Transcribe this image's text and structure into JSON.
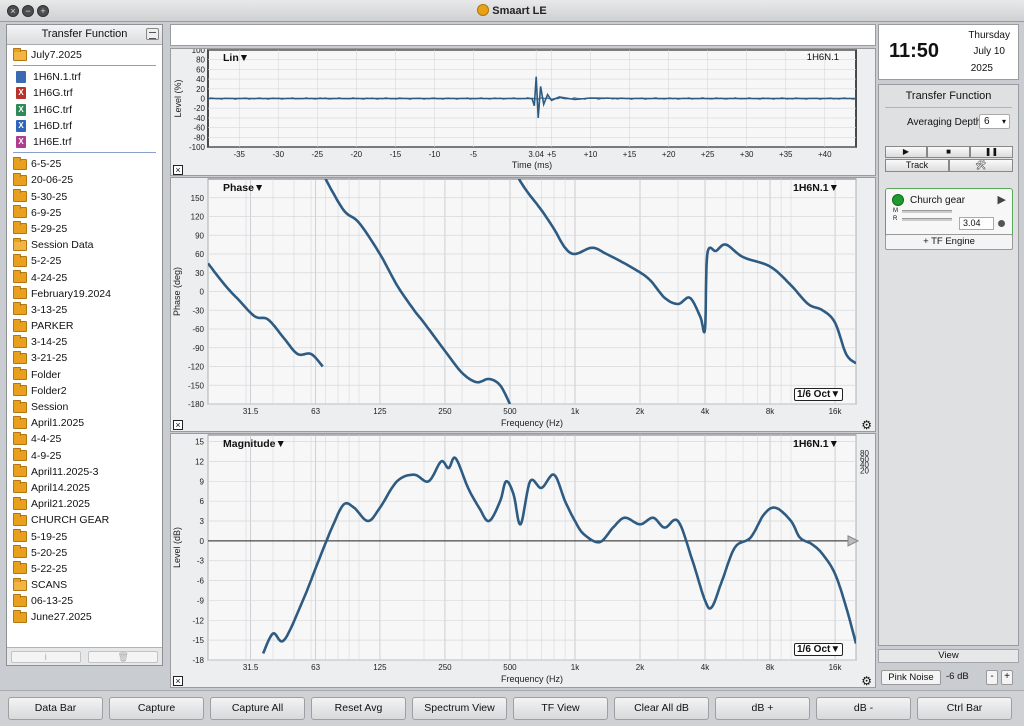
{
  "app": {
    "title": "Smaart LE",
    "traffic": [
      "×",
      "−",
      "+"
    ]
  },
  "sidebar": {
    "title": "Transfer Function",
    "root_folder": "July7.2025",
    "files": [
      {
        "label": "1H6N.1.trf",
        "color": "#3a6ab2",
        "glyph": ""
      },
      {
        "label": "1H6G.trf",
        "color": "#b8322c",
        "glyph": "X"
      },
      {
        "label": "1H6C.trf",
        "color": "#2f8a55",
        "glyph": "X"
      },
      {
        "label": "1H6D.trf",
        "color": "#2f64b8",
        "glyph": "X"
      },
      {
        "label": "1H6E.trf",
        "color": "#b03c8e",
        "glyph": "X"
      }
    ],
    "folders": [
      {
        "label": "6-5-25",
        "open": false
      },
      {
        "label": "20-06-25",
        "open": false
      },
      {
        "label": "5-30-25",
        "open": false
      },
      {
        "label": "6-9-25",
        "open": false
      },
      {
        "label": "5-29-25",
        "open": false
      },
      {
        "label": "Session Data",
        "open": true
      },
      {
        "label": "5-2-25",
        "open": false
      },
      {
        "label": "4-24-25",
        "open": false
      },
      {
        "label": "February19.2024",
        "open": false
      },
      {
        "label": "3-13-25",
        "open": false
      },
      {
        "label": "PARKER",
        "open": false
      },
      {
        "label": "3-14-25",
        "open": false
      },
      {
        "label": "3-21-25",
        "open": false
      },
      {
        "label": "Folder",
        "open": false
      },
      {
        "label": "Folder2",
        "open": false
      },
      {
        "label": "Session",
        "open": false
      },
      {
        "label": "April1.2025",
        "open": false
      },
      {
        "label": "4-4-25",
        "open": false
      },
      {
        "label": "4-9-25",
        "open": false
      },
      {
        "label": "April11.2025-3",
        "open": false
      },
      {
        "label": "April14.2025",
        "open": false
      },
      {
        "label": "April21.2025",
        "open": false
      },
      {
        "label": "CHURCH GEAR",
        "open": false
      },
      {
        "label": "5-19-25",
        "open": false
      },
      {
        "label": "5-20-25",
        "open": false
      },
      {
        "label": "5-22-25",
        "open": false
      },
      {
        "label": "SCANS",
        "open": true
      },
      {
        "label": "06-13-25",
        "open": false
      },
      {
        "label": "June27.2025",
        "open": false
      }
    ],
    "footer": {
      "info": "i",
      "trash": "🗑"
    }
  },
  "plots": {
    "impulse": {
      "mode": "Lin▼",
      "trace": "1H6N.1"
    },
    "phase": {
      "mode": "Phase▼",
      "trace": "1H6N.1▼",
      "smoothing": "1/6 Oct▼"
    },
    "magnitude": {
      "mode": "Magnitude▼",
      "trace": "1H6N.1▼",
      "smoothing": "1/6 Oct▼"
    }
  },
  "chart_data": [
    {
      "type": "line",
      "title": "Lin",
      "xlabel": "Time (ms)",
      "ylabel": "Level (%)",
      "xticks": [
        "-35",
        "-30",
        "-25",
        "-20",
        "-15",
        "-10",
        "-5",
        "3.04",
        "+5",
        "+10",
        "+15",
        "+20",
        "+25",
        "+30",
        "+35",
        "+40"
      ],
      "yticks": [
        "100",
        "80",
        "60",
        "40",
        "20",
        "0",
        "-20",
        "-40",
        "-60",
        "-80",
        "-100"
      ],
      "xlim": [
        -39,
        44
      ],
      "ylim": [
        -100,
        100
      ],
      "series": [
        {
          "name": "1H6N.1",
          "x": [
            -39,
            -20,
            -5,
            2.5,
            2.8,
            3.04,
            3.3,
            3.6,
            4,
            4.5,
            5,
            6,
            8,
            10,
            15,
            20,
            30,
            44
          ],
          "y": [
            0,
            0,
            0,
            0,
            -15,
            45,
            -40,
            25,
            -12,
            8,
            -4,
            3,
            -2,
            1,
            0,
            0,
            0,
            0
          ]
        }
      ]
    },
    {
      "type": "line",
      "title": "Phase",
      "xlabel": "Frequency (Hz)",
      "ylabel": "Phase (deg)",
      "xscale": "log",
      "xticks": [
        "31.5",
        "63",
        "125",
        "250",
        "500",
        "1k",
        "2k",
        "4k",
        "8k",
        "16k"
      ],
      "yticks": [
        "150",
        "120",
        "90",
        "60",
        "30",
        "0",
        "-30",
        "-60",
        "-90",
        "-120",
        "-150",
        "-180"
      ],
      "xlim": [
        20,
        20000
      ],
      "ylim": [
        -180,
        180
      ],
      "series": [
        {
          "name": "1H6N.1",
          "x": [
            20,
            24,
            28,
            33,
            38,
            45,
            52,
            60,
            68,
            70,
            85,
            100,
            125,
            150,
            180,
            200,
            250,
            300,
            350,
            400,
            450,
            500,
            550,
            600,
            700,
            800,
            900,
            1000,
            1200,
            1400,
            1800,
            2200,
            2600,
            3000,
            3400,
            3800,
            4000,
            4100,
            4500,
            5000,
            6000,
            8000,
            10000,
            12000,
            14000,
            16000,
            18000,
            20000
          ],
          "y": [
            45,
            10,
            -15,
            -40,
            -45,
            -75,
            -100,
            -100,
            -120,
            180,
            130,
            110,
            60,
            10,
            -30,
            -50,
            -95,
            -130,
            -145,
            -140,
            -150,
            -180,
            180,
            160,
            130,
            100,
            70,
            60,
            70,
            60,
            40,
            20,
            -10,
            -20,
            -10,
            -40,
            -60,
            60,
            65,
            75,
            55,
            40,
            10,
            -20,
            -30,
            -50,
            -100,
            -115
          ]
        }
      ]
    },
    {
      "type": "line",
      "title": "Magnitude",
      "xlabel": "Frequency (Hz)",
      "ylabel": "Level (dB)",
      "xscale": "log",
      "xticks": [
        "31.5",
        "63",
        "125",
        "250",
        "500",
        "1k",
        "2k",
        "4k",
        "8k",
        "16k"
      ],
      "yticks": [
        "15",
        "12",
        "9",
        "6",
        "3",
        "0",
        "-3",
        "-6",
        "-9",
        "-12",
        "-15",
        "-18"
      ],
      "y2ticks": [
        "80",
        "60",
        "40",
        "20"
      ],
      "xlim": [
        20,
        20000
      ],
      "ylim": [
        -18,
        16
      ],
      "series": [
        {
          "name": "1H6N.1",
          "x": [
            36,
            40,
            45,
            55,
            65,
            75,
            85,
            95,
            110,
            125,
            150,
            180,
            210,
            240,
            260,
            280,
            320,
            360,
            400,
            450,
            480,
            520,
            560,
            620,
            700,
            800,
            900,
            1000,
            1100,
            1300,
            1500,
            1700,
            2000,
            2300,
            2600,
            3000,
            3500,
            4000,
            4300,
            4800,
            5500,
            6500,
            7500,
            8500,
            10000,
            11000,
            12500,
            14000,
            16000,
            18000,
            20000
          ],
          "y": [
            -17,
            -14,
            -15,
            -9,
            -3,
            2,
            5.5,
            5,
            3,
            5,
            9,
            10,
            9,
            12,
            11,
            12.5,
            8,
            5,
            3,
            6,
            9,
            7,
            2.5,
            9,
            8,
            10,
            6,
            3,
            1,
            -0.2,
            2,
            3.5,
            2.5,
            3.5,
            2,
            3,
            -3,
            -9,
            -10,
            -6,
            -1,
            0.5,
            4,
            5,
            3,
            0.5,
            -0.5,
            -2,
            -5,
            -10,
            -15.5
          ]
        }
      ]
    }
  ],
  "clock": {
    "time": "11:50",
    "day": "Thursday",
    "date": "July 10",
    "year": "2025"
  },
  "right_panel": {
    "title": "Transfer Function",
    "averaging_label": "Averaging Depth:",
    "averaging_value": "6",
    "transport": [
      "▶",
      "■",
      "❚❚"
    ],
    "track_label": "Track",
    "tools_label": "🛠",
    "engine": {
      "name": "Church gear",
      "m": "M",
      "r": "R",
      "delay": "3.04"
    },
    "add_engine": "+ TF Engine",
    "view_label": "View",
    "pink_noise": "Pink Noise",
    "pink_level": "-6 dB",
    "minus": "-",
    "plus": "+"
  },
  "toolbar": [
    "Data Bar",
    "Capture",
    "Capture All",
    "Reset Avg",
    "Spectrum View",
    "TF View",
    "Clear All dB",
    "dB +",
    "dB -",
    "Ctrl Bar"
  ],
  "colors": {
    "trace": "#2e5b82",
    "grid": "#d6d8da",
    "plot_bg": "#f7f7f8",
    "sidebar_sep": "#8aa0c8"
  }
}
